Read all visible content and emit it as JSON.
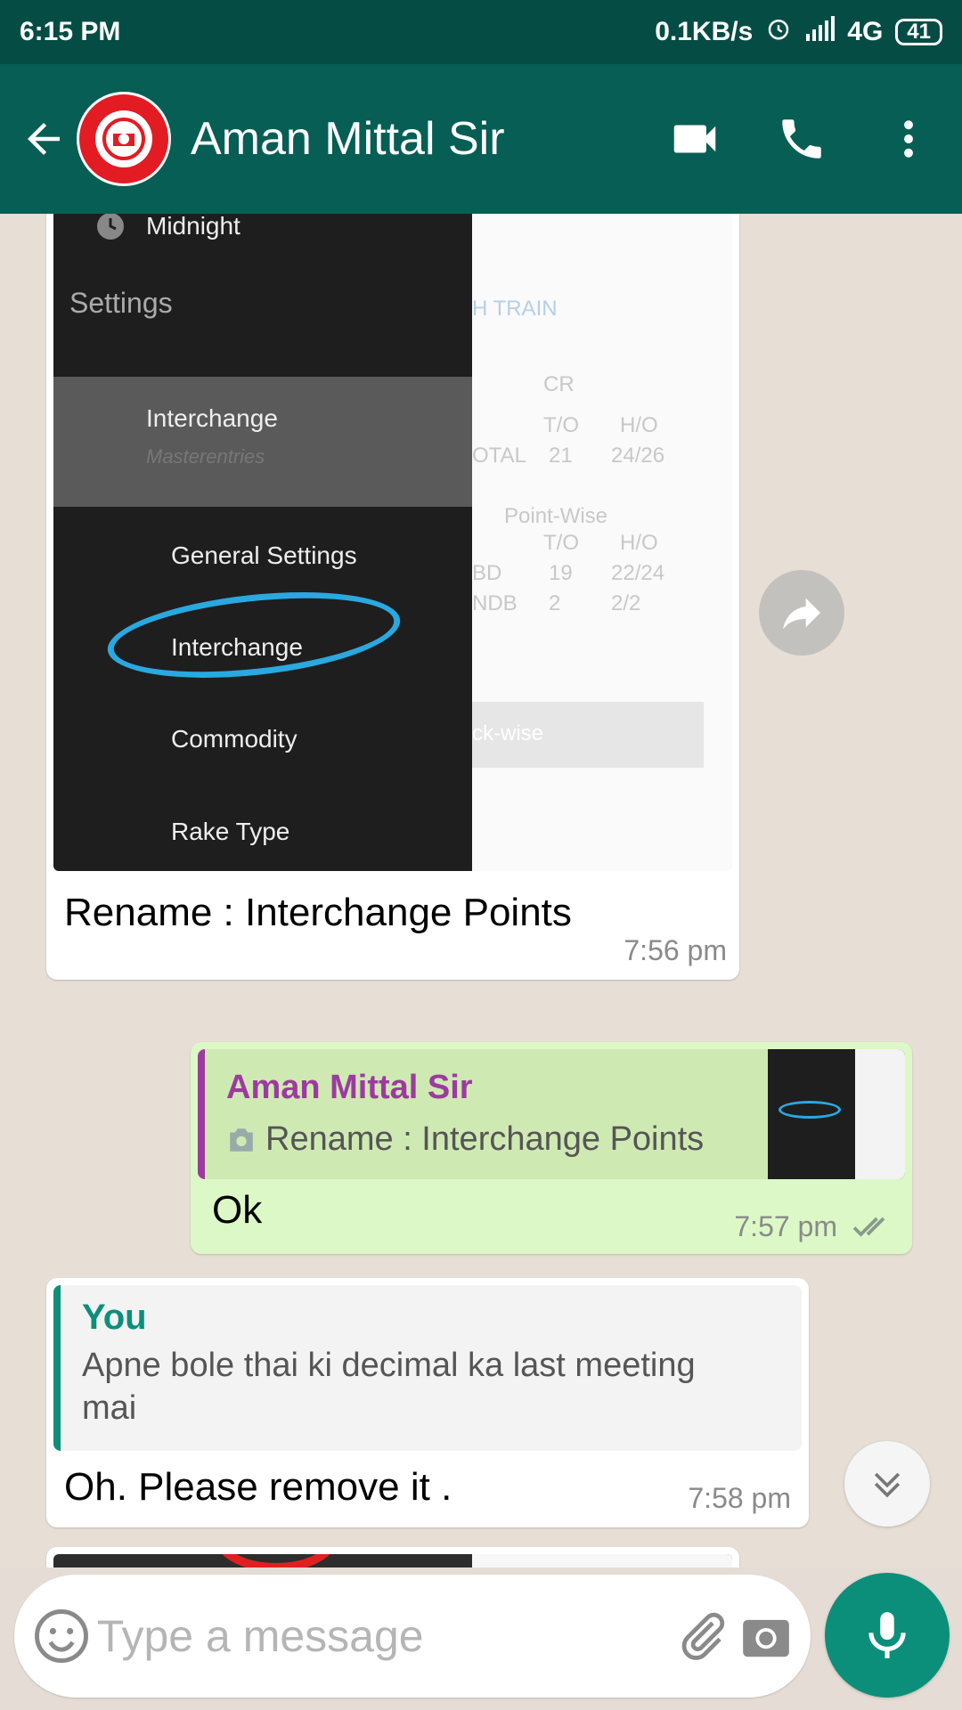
{
  "status_bar": {
    "time": "6:15 PM",
    "speed": "0.1KB/s",
    "network": "4G",
    "battery": "41",
    "icons": [
      "alarm-icon",
      "signal-icon"
    ]
  },
  "header": {
    "contact_name": "Aman Mittal Sir",
    "avatar": "indian-railways-logo",
    "icons": [
      "back-arrow-icon",
      "video-call-icon",
      "phone-icon",
      "more-vert-icon"
    ]
  },
  "colors": {
    "header": "#075e54",
    "status_bar": "#054d44",
    "outgoing_bubble": "#dcf8c6",
    "accent_green": "#0b8f7a",
    "quote_purple": "#9c3b9f"
  },
  "messages": [
    {
      "type": "image",
      "direction": "incoming",
      "image": {
        "drawer_items": {
          "midnight": "Midnight",
          "settings": "Settings",
          "interchange_header": "Interchange",
          "masterentries": "Masterentries",
          "general_settings": "General Settings",
          "interchange": "Interchange",
          "commodity": "Commodity",
          "rake_type": "Rake Type"
        },
        "background": {
          "h_train": "H TRAIN",
          "cr": "CR",
          "to_1": "T/O",
          "ho_1": "H/O",
          "otal": "OTAL",
          "val_21": "21",
          "val_2426": "24/26",
          "point_wise": "Point-Wise",
          "to_2": "T/O",
          "ho_2": "H/O",
          "bd": "BD",
          "val_19": "19",
          "val_2224": "22/24",
          "ndb": "NDB",
          "val_2": "2",
          "val_22": "2/2",
          "ck_wise": "ck-wise"
        }
      },
      "caption": "Rename : Interchange Points",
      "time": "7:56 pm"
    },
    {
      "type": "reply",
      "direction": "outgoing",
      "quote_author": "Aman Mittal Sir",
      "quote_text": "Rename : Interchange Points",
      "text": "Ok",
      "time": "7:57 pm",
      "status": "read"
    },
    {
      "type": "reply",
      "direction": "incoming",
      "quote_author": "You",
      "quote_text": "Apne bole thai ki decimal ka last meeting mai",
      "text": "Oh. Please remove it .",
      "time": "7:58 pm"
    }
  ],
  "input": {
    "placeholder": "Type a message"
  }
}
